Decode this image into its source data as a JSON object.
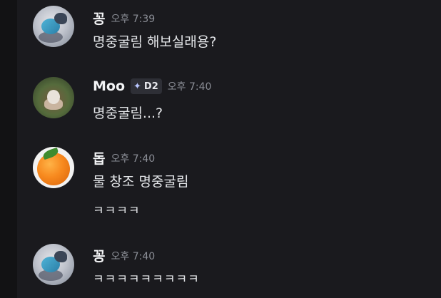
{
  "messages": [
    {
      "author": "꽁",
      "time": "오후 7:39",
      "avatar": "bird-avatar",
      "lines": [
        "명중굴림 해보실래용?"
      ]
    },
    {
      "author": "Moo",
      "badge": {
        "icon": "diamond-sparkle-icon",
        "label": "D2"
      },
      "time": "오후 7:40",
      "avatar": "moo-avatar",
      "lines": [
        "명중굴림...?"
      ]
    },
    {
      "author": "돕",
      "time": "오후 7:40",
      "avatar": "orange-avatar",
      "lines": [
        "물 창조 명중굴림",
        "ㅋㅋㅋㅋ"
      ]
    },
    {
      "author": "꽁",
      "time": "오후 7:40",
      "avatar": "bird-avatar",
      "lines": [
        "ㅋㅋㅋㅋㅋㅋㅋㅋㅋ"
      ]
    }
  ],
  "colors": {
    "background": "#1a1a1e",
    "username": "#f2f3f5",
    "timestamp": "#8b8e96",
    "message_text": "#e3e5e8"
  }
}
